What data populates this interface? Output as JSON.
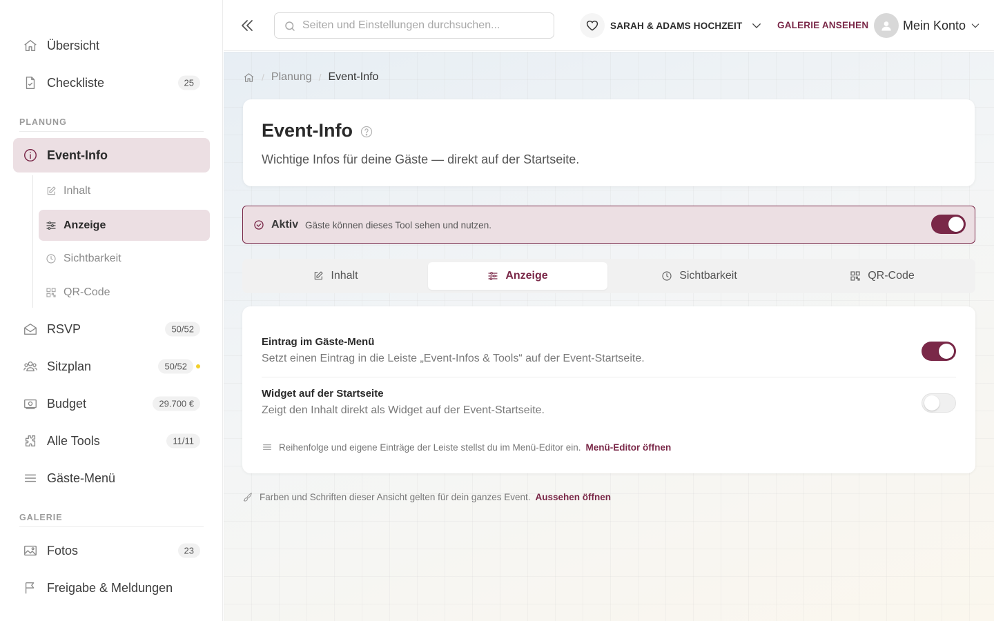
{
  "sidebar": {
    "items": [
      {
        "label": "Übersicht",
        "icon": "home-icon"
      },
      {
        "label": "Checkliste",
        "badge": "25",
        "icon": "checklist-icon"
      }
    ],
    "planning_label": "PLANUNG",
    "event_info": {
      "label": "Event-Info",
      "icon": "info-icon"
    },
    "sub_items": [
      {
        "label": "Inhalt",
        "icon": "edit-icon"
      },
      {
        "label": "Anzeige",
        "icon": "sliders-icon"
      },
      {
        "label": "Sichtbarkeit",
        "icon": "clock-icon"
      },
      {
        "label": "QR-Code",
        "icon": "qr-icon"
      }
    ],
    "planning_items": [
      {
        "label": "RSVP",
        "badge": "50/52",
        "icon": "envelope-icon"
      },
      {
        "label": "Sitzplan",
        "badge": "50/52",
        "icon": "people-icon",
        "dot_color": "#f2cf2a"
      },
      {
        "label": "Budget",
        "badge": "29.700 €",
        "icon": "money-icon"
      },
      {
        "label": "Alle Tools",
        "badge": "11/11",
        "icon": "puzzle-icon"
      },
      {
        "label": "Gäste-Menü",
        "icon": "menu-icon"
      }
    ],
    "gallery_label": "GALERIE",
    "gallery_items": [
      {
        "label": "Fotos",
        "badge": "23",
        "icon": "image-icon"
      },
      {
        "label": "Freigabe & Meldungen",
        "icon": "flag-icon"
      }
    ]
  },
  "topbar": {
    "search_placeholder": "Seiten und Einstellungen durchsuchen...",
    "search_value": "",
    "event_name": "SARAH & ADAMS HOCHZEIT",
    "gallery_link": "GALERIE ANSEHEN",
    "account": "Mein Konto"
  },
  "breadcrumb": {
    "parent": "Planung",
    "current": "Event-Info"
  },
  "header": {
    "title": "Event-Info",
    "subtitle": "Wichtige Infos für deine Gäste — direkt auf der Startseite."
  },
  "status": {
    "title": "Aktiv",
    "description": "Gäste können dieses Tool sehen und nutzen.",
    "enabled": true
  },
  "tabs": [
    {
      "label": "Inhalt",
      "icon": "edit-icon"
    },
    {
      "label": "Anzeige",
      "icon": "sliders-icon",
      "active": true
    },
    {
      "label": "Sichtbarkeit",
      "icon": "clock-icon"
    },
    {
      "label": "QR-Code",
      "icon": "qr-icon"
    }
  ],
  "settings": {
    "rows": [
      {
        "title": "Eintrag im Gäste-Menü",
        "description": "Setzt einen Eintrag in die Leiste „Event-Infos & Tools“ auf der Event-Startseite.",
        "enabled": true
      },
      {
        "title": "Widget auf der Startseite",
        "description": "Zeigt den Inhalt direkt als Widget auf der Event-Startseite.",
        "enabled": false
      }
    ],
    "hint": "Reihenfolge und eigene Einträge der Leiste stellst du im Menü-Editor ein.",
    "hint_link": "Menü-Editor öffnen"
  },
  "footer": {
    "hint": "Farben und Schriften dieser Ansicht gelten für dein ganzes Event.",
    "link": "Aussehen öffnen"
  },
  "colors": {
    "accent": "#7a2848",
    "active_bg": "#ecdfe3"
  }
}
